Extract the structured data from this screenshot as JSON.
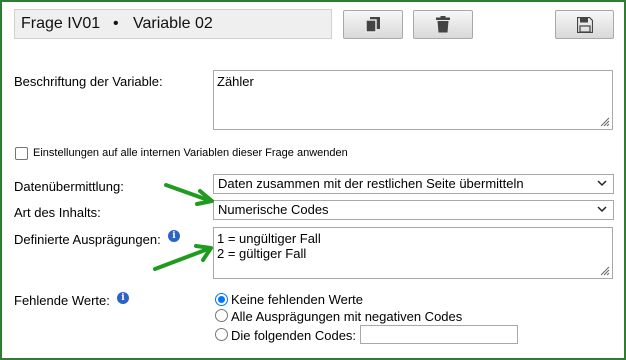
{
  "header": {
    "question": "Frage IV01",
    "separator": "•",
    "variable": "Variable 02"
  },
  "toolbar": {
    "copy_icon": "copy-icon",
    "delete_icon": "trash-icon",
    "save_icon": "floppy-disk-icon"
  },
  "form": {
    "label_field": {
      "label": "Beschriftung der Variable:",
      "value": "Zähler"
    },
    "apply_all": {
      "label": "Einstellungen auf alle internen Variablen dieser Frage anwenden",
      "checked": false
    },
    "transmission": {
      "label": "Datenübermittlung:",
      "selected": "Daten zusammen mit der restlichen Seite übermitteln"
    },
    "content_type": {
      "label": "Art des Inhalts:",
      "selected": "Numerische Codes"
    },
    "defined_values": {
      "label": "Definierte Ausprägungen:",
      "lines": [
        "1 = ungültiger Fall",
        "2 = gültiger Fall"
      ]
    },
    "missing_values": {
      "label": "Fehlende Werte:",
      "options": [
        "Keine fehlenden Werte",
        "Alle Ausprägungen mit negativen Codes",
        "Die folgenden Codes:"
      ],
      "selected_index": 0,
      "codes_value": ""
    }
  },
  "colors": {
    "frame_border": "#2e7d32",
    "arrow": "#1f9b1f",
    "info_icon": "#2b64c4",
    "radio_accent": "#0075ff"
  }
}
